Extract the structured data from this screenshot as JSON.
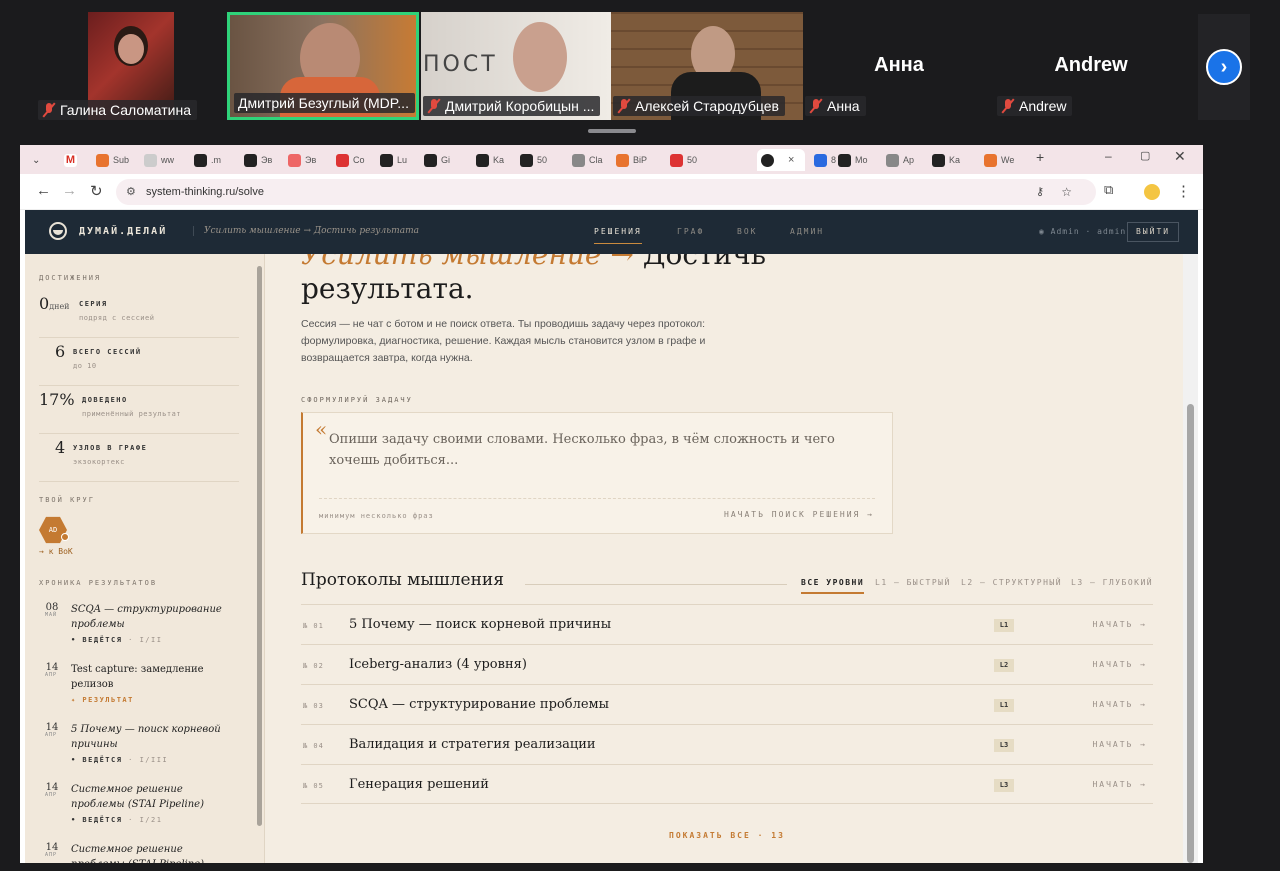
{
  "participants": [
    {
      "name": "Галина Саломатина",
      "video": true,
      "muted": true
    },
    {
      "name": "Дмитрий Безуглый (MDP...",
      "video": true,
      "muted": true,
      "speaking": true
    },
    {
      "name": "Дмитрий Коробицын ...",
      "video": true,
      "muted": true
    },
    {
      "name": "Алексей Стародубцев",
      "video": true,
      "muted": true
    },
    {
      "name": "Анна",
      "video": false,
      "muted": true
    },
    {
      "name": "Andrew",
      "video": false,
      "muted": true
    }
  ],
  "browser": {
    "tabs": [
      "Sub",
      "ww",
      ".m",
      "Эв",
      "Эв",
      "Co",
      "Lu",
      "Gi",
      "Ka",
      "50",
      "Cla",
      "BiP",
      "50",
      "",
      "8",
      "Mo",
      "Ap",
      "Ka",
      "We"
    ],
    "url": "system-thinking.ru/solve"
  },
  "header": {
    "brand": "ДУМАЙ.ДЕЛАЙ",
    "crumb": "Усилить мышление → Достичь результата",
    "nav": [
      "РЕШЕНИЯ",
      "ГРАФ",
      "ВОК",
      "АДМИН"
    ],
    "user": "◉ Admin · admin",
    "logout": "ВЫЙТИ"
  },
  "sidebar": {
    "achievements_title": "ДОСТИЖЕНИЯ",
    "stats": [
      {
        "num": "0",
        "unit": "дней",
        "label": "СЕРИЯ",
        "sub": "подряд с сессией"
      },
      {
        "num": "6",
        "unit": "",
        "label": "ВСЕГО СЕССИЙ",
        "sub": "до 10"
      },
      {
        "num": "17%",
        "unit": "",
        "label": "ДОВЕДЕНО",
        "sub": "применённый результат"
      },
      {
        "num": "4",
        "unit": "",
        "label": "УЗЛОВ В ГРАФЕ",
        "sub": "экзокортекс"
      }
    ],
    "circle_title": "ТВОЙ КРУГ",
    "circle_avatar": "AD",
    "circle_link": "→ к ВоК",
    "chronicle_title": "ХРОНИКА РЕЗУЛЬТАТОВ",
    "chronicle": [
      {
        "day": "08",
        "month": "МАЙ",
        "title": "SCQA — структурирование проблемы",
        "status": "• ВЕДЁТСЯ",
        "frac": "· I/II",
        "italic": true
      },
      {
        "day": "14",
        "month": "АПР",
        "title": "Test capture: замедление релизов",
        "status": "✦ РЕЗУЛЬТАТ",
        "frac": "",
        "italic": false
      },
      {
        "day": "14",
        "month": "АПР",
        "title": "5 Почему — поиск корневой причины",
        "status": "• ВЕДЁТСЯ",
        "frac": "· I/III",
        "italic": true
      },
      {
        "day": "14",
        "month": "АПР",
        "title": "Системное решение проблемы (STAI Pipeline)",
        "status": "• ВЕДЁТСЯ",
        "frac": "· I/21",
        "italic": true
      },
      {
        "day": "14",
        "month": "АПР",
        "title": "Системное решение проблемы (STAI Pipeline)",
        "status": "",
        "frac": "",
        "italic": true
      }
    ]
  },
  "main": {
    "title_accent": "Усилить мышление →",
    "title_rest": "Достичь результата.",
    "intro": "Сессия — не чат с ботом и не поиск ответа. Ты проводишь задачу через протокол: формулировка, диагностика, решение. Каждая мысль становится узлом в графе и возвращается завтра, когда нужна.",
    "task_label": "СФОРМУЛИРУЙ ЗАДАЧУ",
    "task_placeholder": "Опиши задачу своими словами. Несколько фраз, в чём сложность и чего хочешь добиться...",
    "task_min": "минимум несколько фраз",
    "task_go": "НАЧАТЬ ПОИСК РЕШЕНИЯ →",
    "protocols_title": "Протоколы мышления",
    "filters": [
      "ВСЕ УРОВНИ",
      "L1 — БЫСТРЫЙ",
      "L2 — СТРУКТУРНЫЙ",
      "L3 — ГЛУБОКИЙ"
    ],
    "protocols": [
      {
        "no": "№ 01",
        "name": "5 Почему — поиск корневой причины",
        "level": "L1",
        "action": "НАЧАТЬ →"
      },
      {
        "no": "№ 02",
        "name": "Iceberg-анализ (4 уровня)",
        "level": "L2",
        "action": "НАЧАТЬ →"
      },
      {
        "no": "№ 03",
        "name": "SCQA — структурирование проблемы",
        "level": "L1",
        "action": "НАЧАТЬ →"
      },
      {
        "no": "№ 04",
        "name": "Валидация и стратегия реализации",
        "level": "L3",
        "action": "НАЧАТЬ →"
      },
      {
        "no": "№ 05",
        "name": "Генерация решений",
        "level": "L3",
        "action": "НАЧАТЬ →"
      }
    ],
    "show_all": "ПОКАЗАТЬ ВСЕ · 13"
  },
  "colors": {
    "accent": "#c47a32",
    "header_bg": "#1e2a36",
    "page_bg": "#f4ede2"
  }
}
